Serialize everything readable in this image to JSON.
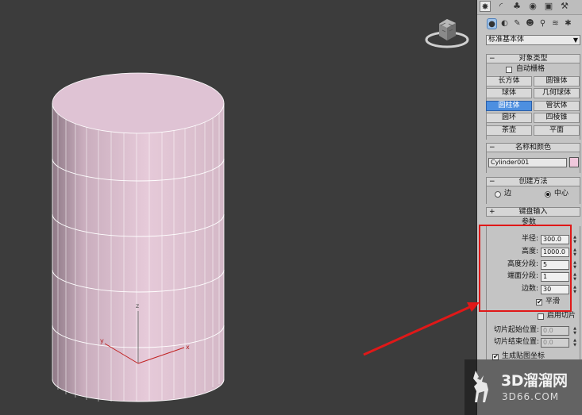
{
  "viewport": {
    "axis_labels": {
      "z": "z",
      "y": "y",
      "x": "x"
    },
    "object_color": "#dfc3d4",
    "background_color": "#3c3c3c"
  },
  "command_panel": {
    "tabs": [
      "create-icon",
      "modify-icon",
      "hierarchy-icon",
      "motion-icon",
      "display-icon",
      "utilities-icon"
    ],
    "sub_tabs": [
      "geometry-icon",
      "shapes-icon",
      "lights-icon",
      "cameras-icon",
      "helpers-icon",
      "spacewarps-icon",
      "systems-icon"
    ],
    "category_dropdown": "标准基本体",
    "object_type": {
      "title": "对象类型",
      "autogrid_label": "自动栅格",
      "buttons": [
        "长方体",
        "圆锥体",
        "球体",
        "几何球体",
        "圆柱体",
        "管状体",
        "圆环",
        "四棱锥",
        "茶壶",
        "平面"
      ],
      "active_button": "圆柱体"
    },
    "name_and_color": {
      "title": "名称和颜色",
      "name_value": "Cylinder001",
      "color": "#f0c8dc"
    },
    "creation_method": {
      "title": "创建方法",
      "options": [
        "边",
        "中心"
      ],
      "selected": "中心"
    },
    "keyboard_entry": {
      "title": "键盘输入"
    },
    "parameters": {
      "title": "参数",
      "radius_label": "半径:",
      "radius_value": "300.0",
      "height_label": "高度:",
      "height_value": "1000.0",
      "height_segments_label": "高度分段:",
      "height_segments_value": "5",
      "cap_segments_label": "端面分段:",
      "cap_segments_value": "1",
      "sides_label": "边数:",
      "sides_value": "30",
      "smooth_label": "平滑",
      "smooth_checked": true,
      "slice_on_label": "启用切片",
      "slice_on_checked": false,
      "slice_from_label": "切片起始位置:",
      "slice_from_value": "0.0",
      "slice_to_label": "切片结束位置:",
      "slice_to_value": "0.0",
      "gen_mapping_label": "生成贴图坐标",
      "gen_mapping_checked": true
    }
  },
  "annotation": {
    "color": "#e01818"
  },
  "watermark": {
    "title": "3D溜溜网",
    "subtitle": "3D66.COM"
  }
}
